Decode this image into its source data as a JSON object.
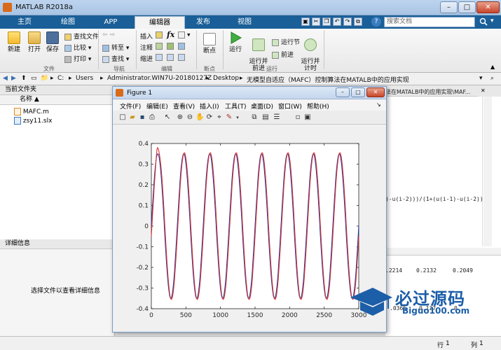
{
  "app": {
    "title": "MATLAB R2018a"
  },
  "tabs": [
    "主页",
    "绘图",
    "APP",
    "编辑器",
    "发布",
    "视图"
  ],
  "active_tab": "编辑器",
  "search": {
    "placeholder": "搜索文档"
  },
  "ribbon": {
    "file_group": {
      "label": "文件",
      "new": "新建",
      "open": "打开",
      "save": "保存",
      "find_files": "查找文件",
      "compare": "比较",
      "print": "打印"
    },
    "nav_group": {
      "label": "导航",
      "goto": "转至",
      "find": "查找"
    },
    "edit_group": {
      "label": "编辑",
      "insert": "插入",
      "comment": "注释",
      "indent": "缩进",
      "fx": "fx"
    },
    "bp_group": {
      "label": "断点",
      "breakpoints": "断点"
    },
    "run_group": {
      "label": "运行",
      "run": "运行",
      "run_advance": "运行并\n前进",
      "run_section": "运行节",
      "advance": "前进",
      "run_time": "运行并\n计时"
    }
  },
  "address": {
    "parts": [
      "C:",
      "Users",
      "Administrator.WIN7U-20180127Z",
      "Desktop",
      "无模型自适应（MAFC）控制算法在MATALB中的应用实现"
    ]
  },
  "left_panel": {
    "title": "当前文件夹",
    "col_name": "名称 ▲",
    "files": [
      {
        "name": "MAFC.m",
        "icon": "m-file-icon"
      },
      {
        "name": "zsy11.slx",
        "icon": "simulink-file-icon"
      }
    ]
  },
  "details": {
    "title": "详细信息",
    "hint": "选择文件以查看详细信息"
  },
  "editor_right": {
    "path_tail": "法在MATALB中的应用实现\\MAF...",
    "code_line": ")-u(i-2)))/(1+(u(i-1)-u(i-2))",
    "workspace_line1": [
      ".2214",
      "0.2132",
      "0.2049"
    ],
    "workspace_line2": [
      ".0365",
      "0.127",
      "0"
    ]
  },
  "status": {
    "row_label": "行",
    "row_value": "1",
    "col_label": "列",
    "col_value": "1"
  },
  "figure": {
    "title": "Figure 1",
    "menu": [
      "文件(F)",
      "编辑(E)",
      "查看(V)",
      "插入(I)",
      "工具(T)",
      "桌面(D)",
      "窗口(W)",
      "帮助(H)"
    ]
  },
  "chart_data": {
    "type": "line",
    "xlim": [
      0,
      3000
    ],
    "ylim": [
      -0.4,
      0.4
    ],
    "xticks": [
      0,
      500,
      1000,
      1500,
      2000,
      2500,
      3000
    ],
    "yticks": [
      0.4,
      0.3,
      0.2,
      0.1,
      0,
      -0.1,
      -0.2,
      -0.3,
      -0.4
    ],
    "ytick_labels": [
      "0.4",
      "0.3",
      "0.2",
      "0.1",
      "0",
      "-0.1",
      "-0.2",
      "-0.3",
      "-0.4"
    ],
    "series": [
      {
        "color": "#1f3f9f",
        "amplitude": 0.35,
        "period": 375,
        "phase_deg": 0
      },
      {
        "color": "#e03030",
        "amplitude": 0.355,
        "period": 375,
        "phase_deg": -8,
        "initial_peak": {
          "x": 90,
          "y": 0.38
        }
      }
    ]
  },
  "watermark": {
    "text": "必过源码",
    "url": "Biguo100.com"
  }
}
